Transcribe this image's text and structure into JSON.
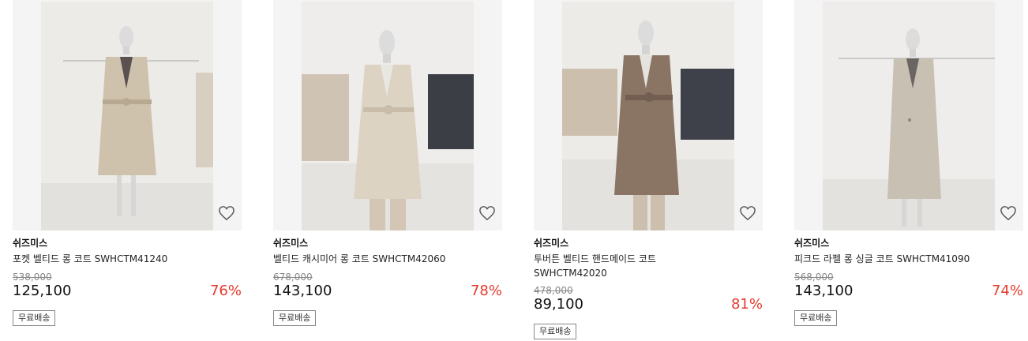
{
  "products": [
    {
      "brand": "쉬즈미스",
      "name": "포켓 벨티드 롱 코트 SWHCTM41240",
      "original_price": "538,000",
      "price": "125,100",
      "discount": "76%",
      "badge": "무료배송",
      "coat_color": "#cfc2ac"
    },
    {
      "brand": "쉬즈미스",
      "name": "벨티드 캐시미어 롱 코트 SWHCTM42060",
      "original_price": "678,000",
      "price": "143,100",
      "discount": "78%",
      "badge": "무료배송",
      "coat_color": "#ddd3c2"
    },
    {
      "brand": "쉬즈미스",
      "name": "투버튼 벨티드 핸드메이드 코트 SWHCTM42020",
      "original_price": "478,000",
      "price": "89,100",
      "discount": "81%",
      "badge": "무료배송",
      "coat_color": "#8a7565"
    },
    {
      "brand": "쉬즈미스",
      "name": "피크드 라펠 롱 싱글 코트 SWHCTM41090",
      "original_price": "568,000",
      "price": "143,100",
      "discount": "74%",
      "badge": "무료배송",
      "coat_color": "#c8c0b2"
    }
  ],
  "icons": {
    "wishlist": "heart-outline-icon"
  },
  "colors": {
    "discount": "#e63a2e",
    "text": "#111111",
    "muted": "#888888"
  }
}
